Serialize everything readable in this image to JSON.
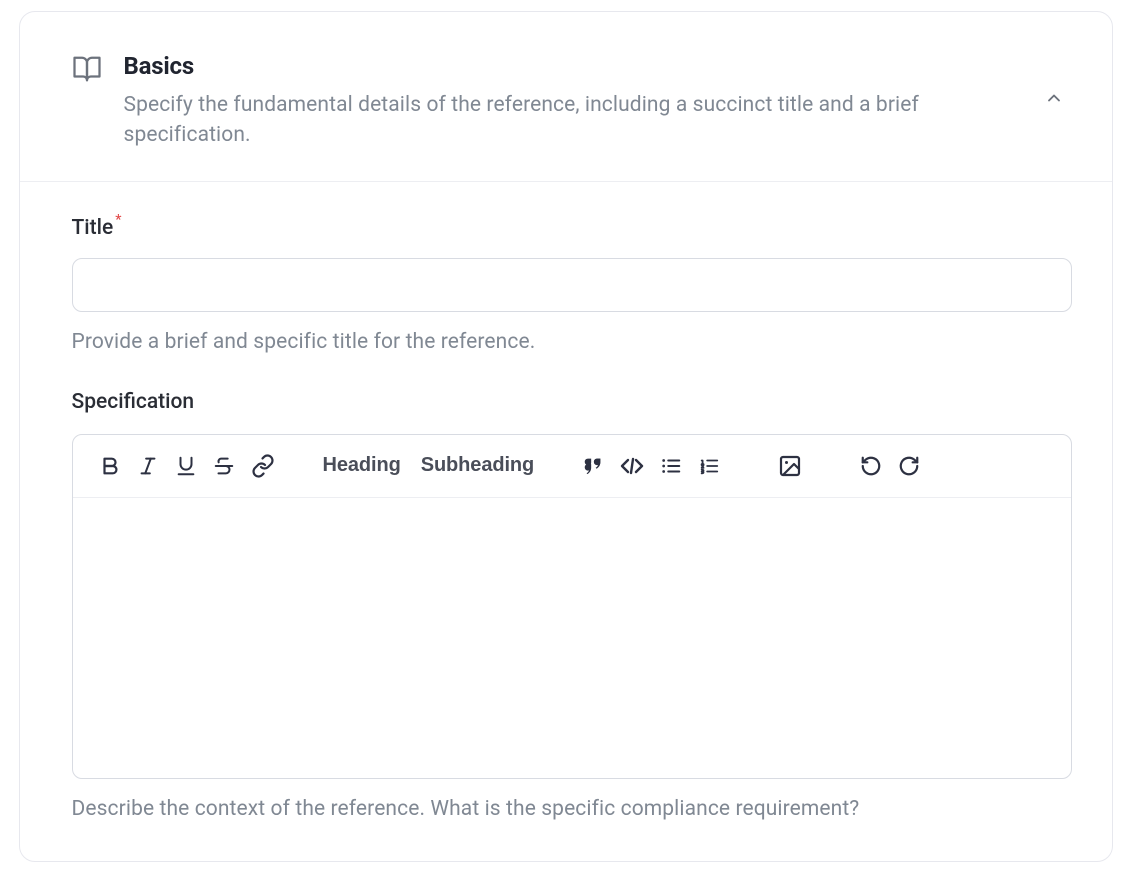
{
  "panel": {
    "title": "Basics",
    "description": "Specify the fundamental details of the reference, including a succinct title and a brief specification."
  },
  "fields": {
    "title": {
      "label": "Title",
      "required_marker": "*",
      "value": "",
      "help": "Provide a brief and specific title for the reference."
    },
    "specification": {
      "label": "Specification",
      "value": "",
      "help": "Describe the context of the reference. What is the specific compliance requirement?"
    }
  },
  "toolbar": {
    "heading": "Heading",
    "subheading": "Subheading"
  }
}
